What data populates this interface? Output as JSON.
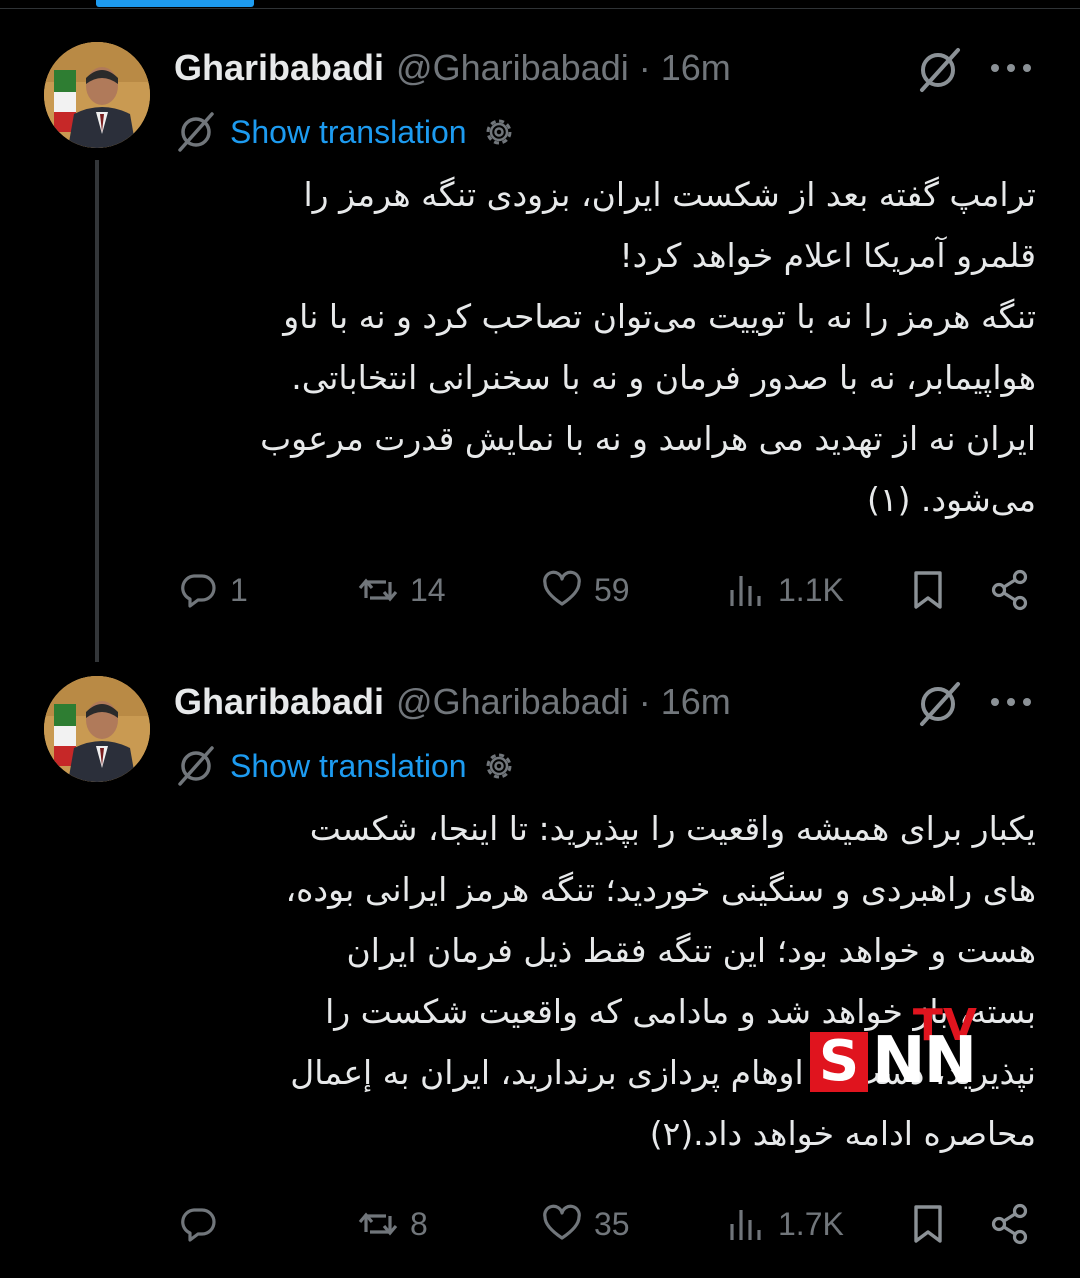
{
  "tweets": [
    {
      "author_name": "Gharibabadi",
      "handle": "@Gharibabadi",
      "separator": "·",
      "time": "16m",
      "show_translation": "Show translation",
      "text": "ترامپ گفته بعد از شکست ایران، بزودی تنگه هرمز را\nقلمرو آمریکا اعلام خواهد کرد!\nتنگه هرمز را نه با توییت می‌توان تصاحب کرد و نه با ناو\nهواپیمابر، نه با صدور فرمان و نه با سخنرانی انتخاباتی.\nایران نه از تهدید می هراسد و نه با نمایش قدرت مرعوب\nمی‌شود. (۱)",
      "replies": "1",
      "reposts": "14",
      "likes": "59",
      "views": "1.1K"
    },
    {
      "author_name": "Gharibabadi",
      "handle": "@Gharibabadi",
      "separator": "·",
      "time": "16m",
      "show_translation": "Show translation",
      "text": "یکبار برای همیشه واقعیت را بپذیرید: تا اینجا، شکست\nهای راهبردی و سنگینی خوردید؛ تنگه هرمز ایرانی بوده،\nهست و خواهد بود؛ این تنگه فقط ذیل فرمان ایران\nبسته، باز خواهد شد و مادامی که واقعیت شکست را\nنپذیرید، دست از اوهام پردازی برندارید، ایران به إعمال\nمحاصره ادامه خواهد داد.(۲)",
      "replies": "",
      "reposts": "8",
      "likes": "35",
      "views": "1.7K"
    }
  ],
  "watermark": {
    "top": "TV",
    "s": "S",
    "nn": "NN"
  },
  "colors": {
    "background": "#000000",
    "link": "#1d9bf0",
    "muted": "#71767b",
    "text": "#e7e9ea",
    "brand_red": "#e0141e"
  },
  "icons": [
    "grok-icon",
    "more-icon",
    "settings-gear-icon",
    "reply-icon",
    "repost-icon",
    "like-icon",
    "views-icon",
    "bookmark-icon",
    "share-icon"
  ]
}
